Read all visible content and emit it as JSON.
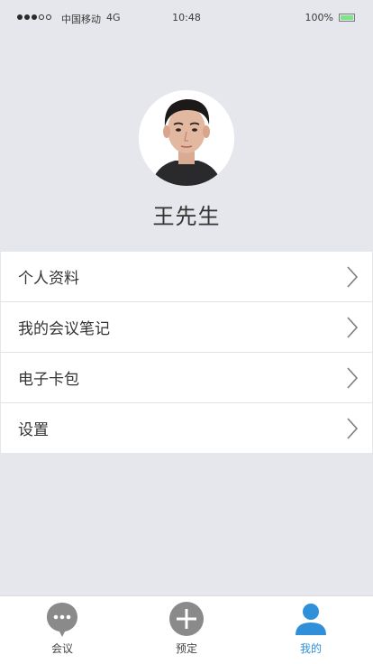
{
  "status_bar": {
    "carrier": "中国移动",
    "network": "4G",
    "time": "10:48",
    "battery": "100%"
  },
  "profile": {
    "name": "王先生"
  },
  "menu": {
    "items": [
      {
        "label": "个人资料"
      },
      {
        "label": "我的会议笔记"
      },
      {
        "label": "电子卡包"
      },
      {
        "label": "设置"
      }
    ]
  },
  "tabs": [
    {
      "label": "会议",
      "icon": "chat-bubble-icon",
      "active": false
    },
    {
      "label": "预定",
      "icon": "plus-circle-icon",
      "active": false
    },
    {
      "label": "我的",
      "icon": "user-icon",
      "active": true
    }
  ],
  "colors": {
    "background": "#e6e7ec",
    "active_tab": "#2f8fd8",
    "inactive_icon": "#8a8a8a",
    "battery": "#7de48a"
  }
}
